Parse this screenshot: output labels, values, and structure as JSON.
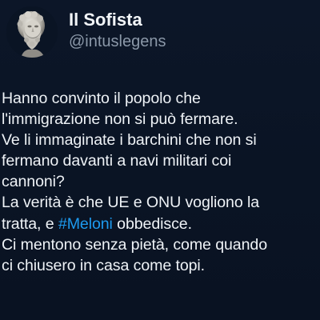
{
  "author": {
    "display_name": "Il Sofista",
    "handle": "@intuslegens",
    "avatar_icon": "greek-philosopher-bust-avatar"
  },
  "tweet": {
    "lines": [
      "Hanno convinto il popolo che",
      "l'immigrazione non si può fermare.",
      "Ve li immaginate i barchini che non si",
      "fermano davanti a navi militari coi",
      "cannoni?",
      "La verità è che UE e ONU vogliono la"
    ],
    "hashtag_line": {
      "before": "tratta, e ",
      "hashtag": "#Meloni",
      "after": " obbedisce."
    },
    "lines_end": [
      "Ci mentono senza pietà, come quando",
      "ci chiusero in casa come topi."
    ]
  },
  "colors": {
    "background": "#0b1527",
    "text": "#eef2f6",
    "handle": "#8b98a8",
    "hashtag": "#1d9bf0"
  }
}
